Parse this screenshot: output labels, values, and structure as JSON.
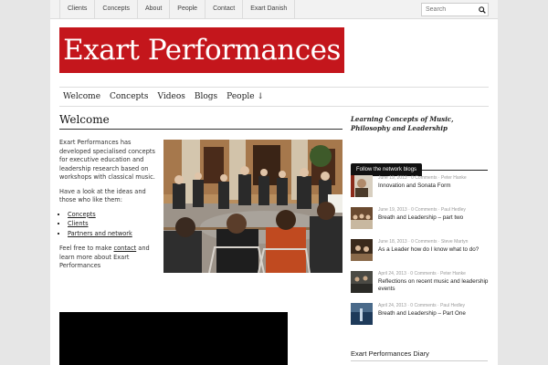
{
  "topnav": {
    "items": [
      "Clients",
      "Concepts",
      "About",
      "People",
      "Contact",
      "Exart Danish"
    ],
    "search_placeholder": "Search"
  },
  "logo": {
    "text": "Exart Performances"
  },
  "mainnav": {
    "items": [
      "Welcome",
      "Concepts",
      "Videos",
      "Blogs",
      "People ↓"
    ]
  },
  "main": {
    "title": "Welcome",
    "intro_p1": "Exart Performances has developed specialised concepts for executive education and leadership research based on workshops with classical music.",
    "intro_p2": "Have a look at the ideas and those who like them:",
    "links": [
      "Concepts",
      "Clients",
      "Partners and network"
    ],
    "outro_prefix": "Feel free to make ",
    "outro_link": "contact",
    "outro_suffix": " and learn more about Exart Performances"
  },
  "sidebar": {
    "tagline": "Learning Concepts of Music, Philosophy and Leadership",
    "tab": "Follow the network blogs",
    "posts": [
      {
        "meta": "June 19, 2013 · 0 Comments · Peter Hanke",
        "title": "Innovation and Sonata Form"
      },
      {
        "meta": "June 19, 2013 · 0 Comments · Paul Hedley",
        "title": "Breath and Leadership – part two"
      },
      {
        "meta": "June 18, 2013 · 0 Comments · Steve Martyn",
        "title": "As a Leader how do I know what to do?"
      },
      {
        "meta": "April 24, 2013 · 0 Comments · Peter Hanke",
        "title": "Reflections on recent music and leadership events"
      },
      {
        "meta": "April 24, 2013 · 0 Comments · Paul Hedley",
        "title": "Breath and Leadership – Part One"
      }
    ],
    "diary_title": "Exart Performances Diary"
  },
  "colors": {
    "brand_red": "#c4161c",
    "background": "#e6e6e6"
  }
}
